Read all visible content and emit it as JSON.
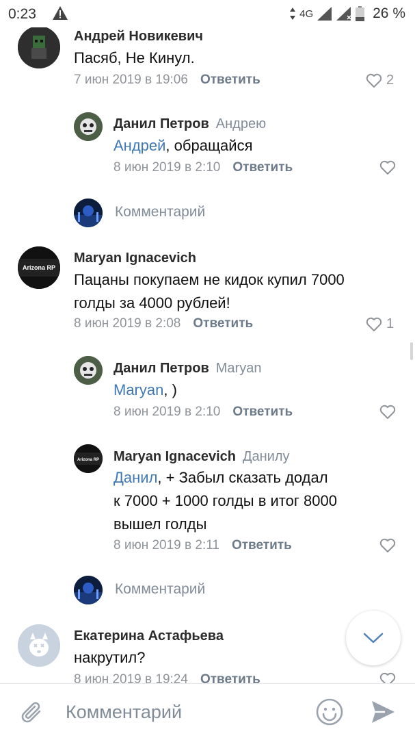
{
  "status_bar": {
    "time": "0:23",
    "network": "4G",
    "battery": "26 %"
  },
  "comments": [
    {
      "author": "Андрей Новикевич",
      "reply_to": "",
      "mention": "",
      "text": "Пасяб, Не Кинул.",
      "date": "7 июн 2019 в 19:06",
      "likes": "2"
    },
    {
      "author": "Данил Петров",
      "reply_to": "Андрею",
      "mention": "Андрей",
      "text": ", обращайся",
      "date": "8 июн 2019 в 2:10",
      "likes": ""
    },
    {
      "author": "Maryan Ignacevich",
      "reply_to": "",
      "mention": "",
      "text_lines": [
        "Пацаны покупаем не кидок купил 7000",
        "голды за 4000 рублей!"
      ],
      "date": "8 июн 2019 в 2:08",
      "likes": "1"
    },
    {
      "author": "Данил Петров",
      "reply_to": "Maryan",
      "mention": "Maryan",
      "text": ", )",
      "date": "8 июн 2019 в 2:10",
      "likes": ""
    },
    {
      "author": "Maryan Ignacevich",
      "reply_to": "Данилу",
      "mention": "Данил",
      "text_lines": [
        ", + Забыл сказать додал",
        "к 7000 + 1000 голды в итог 8000",
        "вышел голды"
      ],
      "date": "8 июн 2019 в 2:11",
      "likes": ""
    },
    {
      "author": "Екатерина Астафьева",
      "reply_to": "",
      "mention": "",
      "text": "накрутил?",
      "date": "8 июн 2019 в 19:24",
      "likes": ""
    }
  ],
  "reply_label": "Ответить",
  "comment_link_label": "Комментарий",
  "avatar_text": "Arizona RP",
  "composer": {
    "placeholder": "Комментарий"
  },
  "colors": {
    "link": "#3f78b3",
    "meta": "#909499",
    "accent": "#5181b8"
  }
}
